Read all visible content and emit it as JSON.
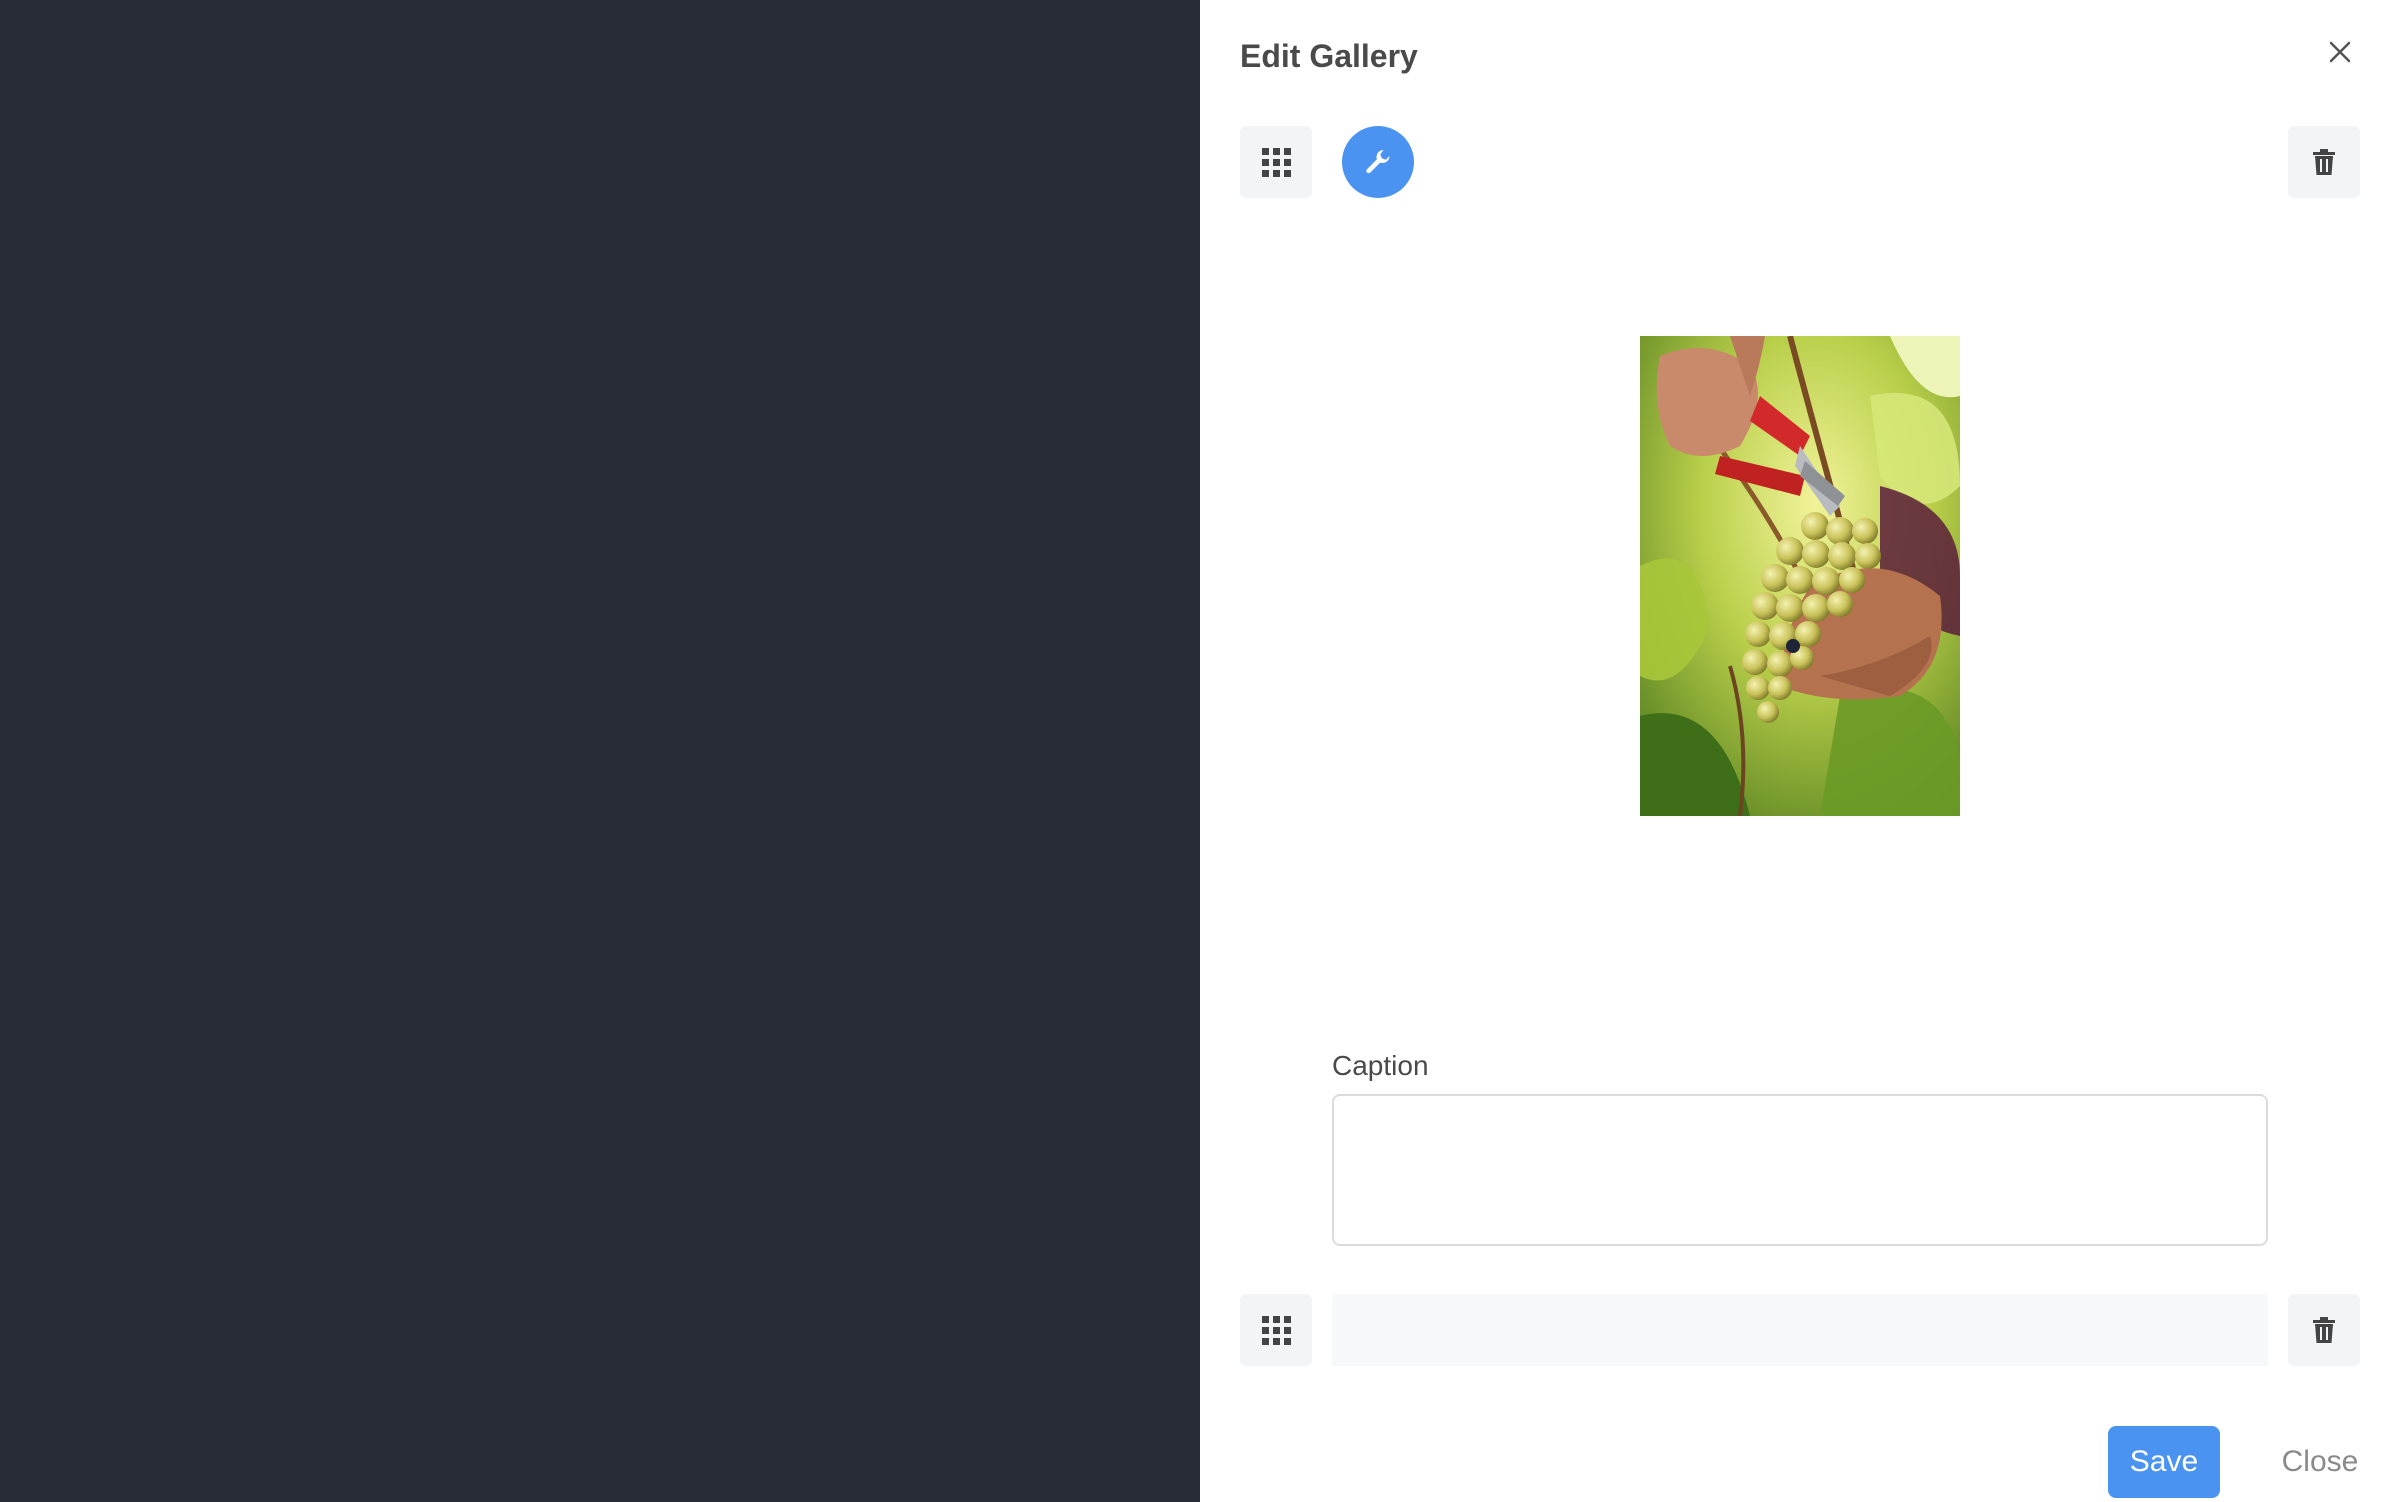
{
  "dialog": {
    "title": "Edit Gallery"
  },
  "icons": {
    "close": "close-icon",
    "drag": "drag-handle-grid-icon",
    "edit": "wrench-icon",
    "delete": "trash-icon"
  },
  "image": {
    "subject": "hands pruning a bunch of green grapes on the vine"
  },
  "caption": {
    "label": "Caption",
    "value": ""
  },
  "footer": {
    "save_label": "Save",
    "close_label": "Close"
  },
  "colors": {
    "backdrop": "#282c34",
    "primary": "#4b93f1",
    "panel": "#ffffff"
  }
}
